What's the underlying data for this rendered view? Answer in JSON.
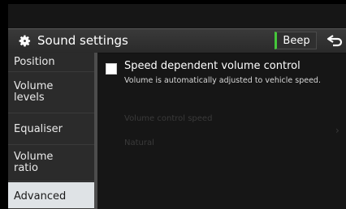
{
  "header": {
    "title": "Sound settings",
    "beep_label": "Beep"
  },
  "sidebar": {
    "items": [
      {
        "label": "Position"
      },
      {
        "label": "Volume levels"
      },
      {
        "label": "Equaliser"
      },
      {
        "label": "Volume ratio"
      },
      {
        "label": "Advanced"
      }
    ]
  },
  "content": {
    "speed_volume": {
      "label": "Speed dependent volume control",
      "description": "Volume is automatically adjusted to vehicle speed.",
      "checked": false
    },
    "dim_setting_label": "Volume control speed",
    "dim_setting_value": "Natural"
  },
  "colors": {
    "accent_green": "#45c73a",
    "active_item_bg": "#dfe3e6"
  }
}
